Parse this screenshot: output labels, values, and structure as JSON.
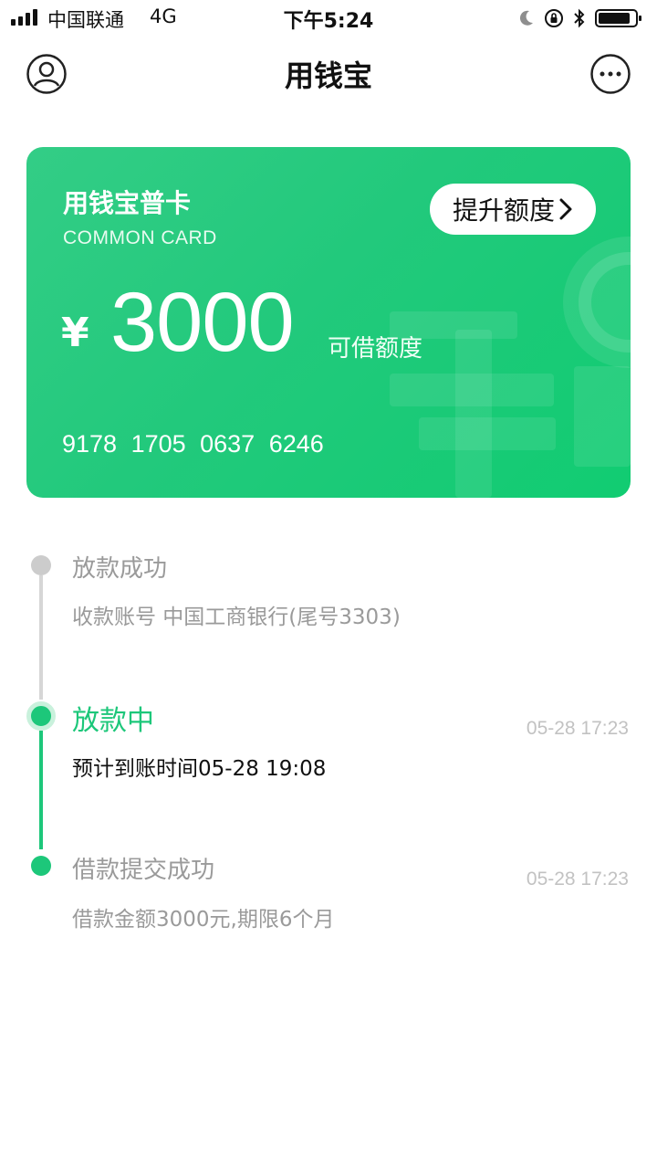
{
  "status_bar": {
    "carrier": "中国联通",
    "network": "4G",
    "time": "下午5:24"
  },
  "nav": {
    "title": "用钱宝"
  },
  "card": {
    "name": "用钱宝普卡",
    "subtitle": "COMMON CARD",
    "upgrade_label": "提升额度",
    "currency": "¥",
    "amount": "3000",
    "amount_label": "可借额度",
    "number": "9178  1705  0637  6246"
  },
  "timeline": [
    {
      "title": "放款成功",
      "desc": "收款账号 中国工商银行(尾号3303)",
      "time": ""
    },
    {
      "title": "放款中",
      "desc": "预计到账时间05-28 19:08",
      "time": "05-28 17:23"
    },
    {
      "title": "借款提交成功",
      "desc": "借款金额3000元,期限6个月",
      "time": "05-28 17:23"
    }
  ],
  "colors": {
    "accent": "#1dc77a",
    "card_start": "#33cd86",
    "card_end": "#11cc72",
    "inactive": "#c8c8c8",
    "muted_text": "#9a9a9a"
  },
  "icons": {
    "signal": "signal-icon",
    "moon": "moon-icon",
    "rotation_lock": "rotation-lock-icon",
    "bluetooth": "bluetooth-icon",
    "battery": "battery-icon",
    "user": "user-icon",
    "more": "more-icon",
    "chevron": "chevron-right-icon"
  }
}
